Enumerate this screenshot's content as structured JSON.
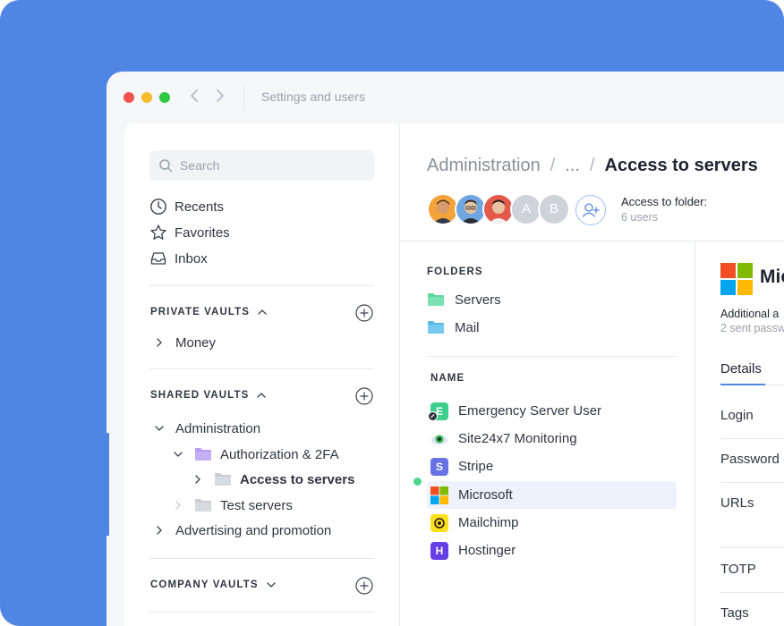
{
  "window": {
    "title": "Settings and users"
  },
  "sidebar": {
    "search_placeholder": "Search",
    "nav": [
      {
        "label": "Recents",
        "icon": "clock-icon"
      },
      {
        "label": "Favorites",
        "icon": "star-icon"
      },
      {
        "label": "Inbox",
        "icon": "inbox-icon"
      }
    ],
    "private_vaults": {
      "title": "PRIVATE VAULTS",
      "items": [
        "Money"
      ]
    },
    "shared_vaults": {
      "title": "SHARED VAULTS",
      "items": {
        "administration": "Administration",
        "auth": "Authorization & 2FA",
        "access": "Access to servers",
        "test": "Test servers",
        "advertising": "Advertising and promotion"
      }
    },
    "company_vaults": {
      "title": "COMPANY VAULTS"
    }
  },
  "content": {
    "breadcrumb": {
      "root": "Administration",
      "ellipsis": "...",
      "current": "Access to servers"
    },
    "avatars": [
      "A",
      "B"
    ],
    "access": {
      "title": "Access to folder:",
      "subtitle": "6 users"
    },
    "folders": {
      "title": "FOLDERS",
      "items": [
        "Servers",
        "Mail"
      ]
    },
    "names": {
      "title": "NAME",
      "items": [
        {
          "label": "Emergency Server User",
          "icon_letter": "E",
          "color": "#3ecf8e"
        },
        {
          "label": "Site24x7 Monitoring",
          "icon_letter": "",
          "color": "#e6e8ec"
        },
        {
          "label": "Stripe",
          "icon_letter": "S",
          "color": "#6772e5"
        },
        {
          "label": "Microsoft",
          "icon_letter": "",
          "color": "#ffffff"
        },
        {
          "label": "Mailchimp",
          "icon_letter": "",
          "color": "#ffe01b"
        },
        {
          "label": "Hostinger",
          "icon_letter": "H",
          "color": "#673de6"
        }
      ]
    },
    "detail": {
      "name": "Mic",
      "additional": "Additional a",
      "sent": "2 sent passw",
      "tab": "Details",
      "fields": [
        "Login",
        "Password",
        "URLs",
        "TOTP",
        "Tags"
      ]
    }
  },
  "colors": {
    "accent": "#4f86e3",
    "background": "#4f86e3"
  }
}
